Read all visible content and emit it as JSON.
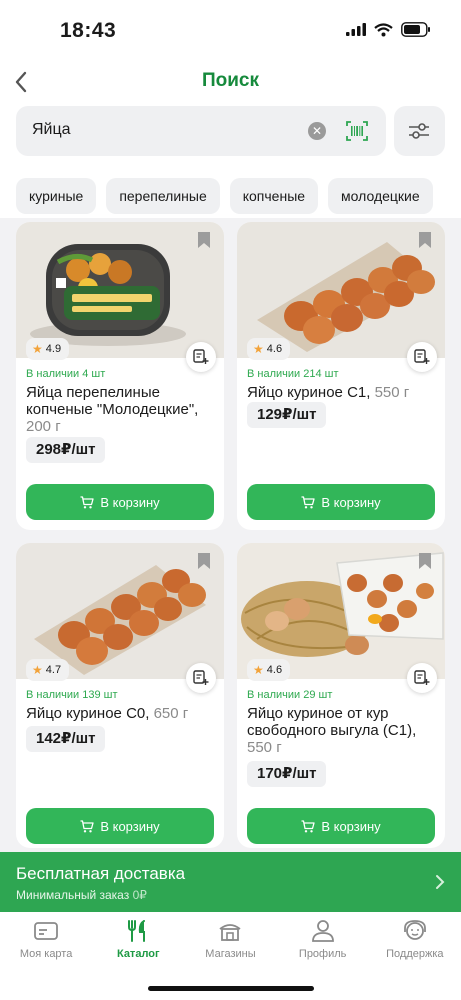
{
  "status": {
    "time": "18:43"
  },
  "header": {
    "title": "Поиск"
  },
  "search": {
    "query": "Яйца"
  },
  "chips": [
    "куриные",
    "перепелиные",
    "копченые",
    "молодецкие"
  ],
  "products": [
    {
      "rating": "4.9",
      "stock": "В наличии 4 шт",
      "name": "Яйца перепелиные копченые \"Молодецкие\",",
      "weight": "200 г",
      "price": "298₽/шт",
      "button": "В корзину"
    },
    {
      "rating": "4.6",
      "stock": "В наличии 214 шт",
      "name": "Яйцо куриное С1,",
      "weight": "550 г",
      "price": "129₽/шт",
      "button": "В корзину"
    },
    {
      "rating": "4.7",
      "stock": "В наличии 139 шт",
      "name": "Яйцо куриное С0,",
      "weight": "650 г",
      "price": "142₽/шт",
      "button": "В корзину"
    },
    {
      "rating": "4.6",
      "stock": "В наличии 29 шт",
      "name": "Яйцо куриное от кур свободного выгула (С1),",
      "weight": "550 г",
      "price": "170₽/шт",
      "button": "В корзину"
    }
  ],
  "delivery": {
    "title": "Бесплатная доставка",
    "subtitle_label": "Минимальный заказ",
    "min_order": "0₽"
  },
  "tabs": [
    {
      "label": "Моя карта",
      "icon": "card-icon"
    },
    {
      "label": "Каталог",
      "icon": "cutlery-icon"
    },
    {
      "label": "Магазины",
      "icon": "store-icon"
    },
    {
      "label": "Профиль",
      "icon": "profile-icon"
    },
    {
      "label": "Поддержка",
      "icon": "support-icon"
    }
  ],
  "colors": {
    "accent": "#168a3c",
    "button": "#32b659",
    "delivery_bar": "#2ea652",
    "stock_text": "#2ea94f"
  }
}
